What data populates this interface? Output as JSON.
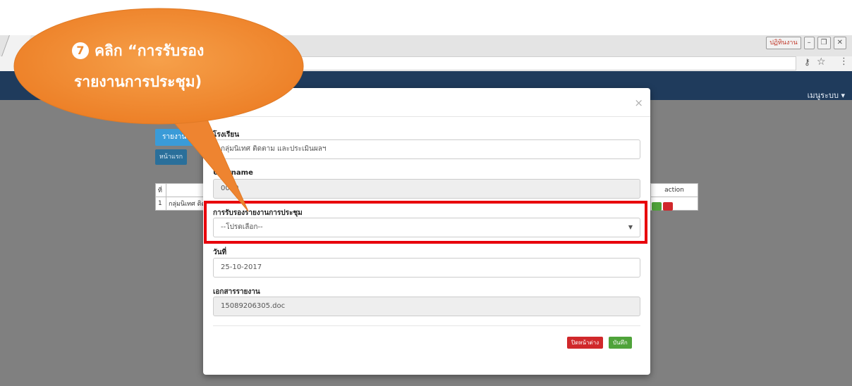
{
  "browser": {
    "window_user": "ปฏิทินงาน",
    "window_buttons": [
      "–",
      "❐",
      "✕"
    ],
    "icons": {
      "key": "key-icon",
      "star": "star-icon",
      "menu": "menu-icon"
    }
  },
  "navbar": {
    "menu_label": "เมนูระบบ ▾",
    "bg_color": "#1f3b5c"
  },
  "background": {
    "report_button": "รายงาน",
    "home_button": "หน้าแรก",
    "table": {
      "headers": [
        "ที่",
        "",
        "",
        "action"
      ],
      "rows": [
        [
          "1",
          "กลุ่มนิเทศ ติดตาม",
          "",
          ""
        ]
      ]
    }
  },
  "modal": {
    "close": "×",
    "school_label": "โรงเรียน",
    "school_value": "กลุ่มนิเทศ ติดตาม และประเมินผลฯ",
    "username_label": "Username",
    "username_value": "0000",
    "approve_label": "การรับรองรายงานการประชุม",
    "approve_selected": "--โปรดเลือก--",
    "date_label": "วันที่",
    "date_value": "25-10-2017",
    "doc_label": "เอกสารรายงาน",
    "doc_value": "15089206305.doc",
    "close_button": "ปิดหน้าต่าง",
    "save_button": "บันทึก"
  },
  "callout": {
    "step": "7",
    "line1": "คลิก “การรับรอง",
    "line2": "รายงานการประชุม)",
    "color": "#f08a2c"
  },
  "highlight_color": "#e8000b"
}
